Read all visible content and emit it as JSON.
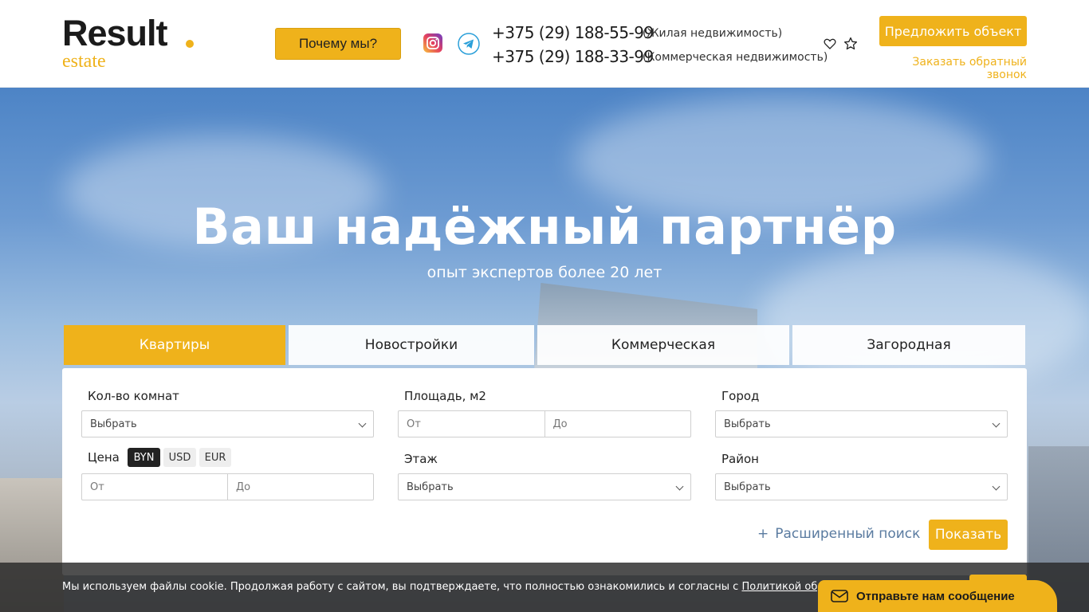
{
  "brand": {
    "logo_main": "Result",
    "logo_sub": "estate",
    "accent": "#efb21b"
  },
  "header": {
    "why_label": "Почему мы?",
    "phones": [
      {
        "number": "+375 (29) 188-55-99",
        "note": "(Жилая недвижимость)"
      },
      {
        "number": "+375 (29) 188-33-99",
        "note": "(Коммерческая недвижимость)"
      }
    ],
    "offer_label": "Предложить объект",
    "callback_label": "Заказать обратный звонок",
    "icons": [
      "instagram-icon",
      "telegram-icon",
      "heart-icon",
      "star-icon"
    ]
  },
  "hero": {
    "title": "Ваш надёжный партнёр",
    "subtitle": "опыт экспертов более 20 лет"
  },
  "tabs": [
    {
      "label": "Квартиры",
      "active": true
    },
    {
      "label": "Новостройки",
      "active": false
    },
    {
      "label": "Коммерческая",
      "active": false
    },
    {
      "label": "Загородная",
      "active": false
    }
  ],
  "search": {
    "rooms_label": "Кол-во комнат",
    "rooms_value": "Выбрать",
    "area_label": "Площадь, м2",
    "area_from": "От",
    "area_to": "До",
    "city_label": "Город",
    "city_value": "Выбрать",
    "price_label": "Цена",
    "currencies": [
      {
        "label": "BYN",
        "active": true
      },
      {
        "label": "USD",
        "active": false
      },
      {
        "label": "EUR",
        "active": false
      }
    ],
    "price_from": "От",
    "price_to": "До",
    "floor_label": "Этаж",
    "floor_value": "Выбрать",
    "district_label": "Район",
    "district_value": "Выбрать",
    "advanced_label": "Расширенный поиск",
    "show_label": "Показать"
  },
  "cookie": {
    "text": "Мы используем файлы cookie. Продолжая работу с сайтом, вы подтверждаете, что полностью ознакомились и согласны с ",
    "link": "Политикой обработки персональных"
  },
  "widget": {
    "label": "Отправьте нам сообщение"
  }
}
